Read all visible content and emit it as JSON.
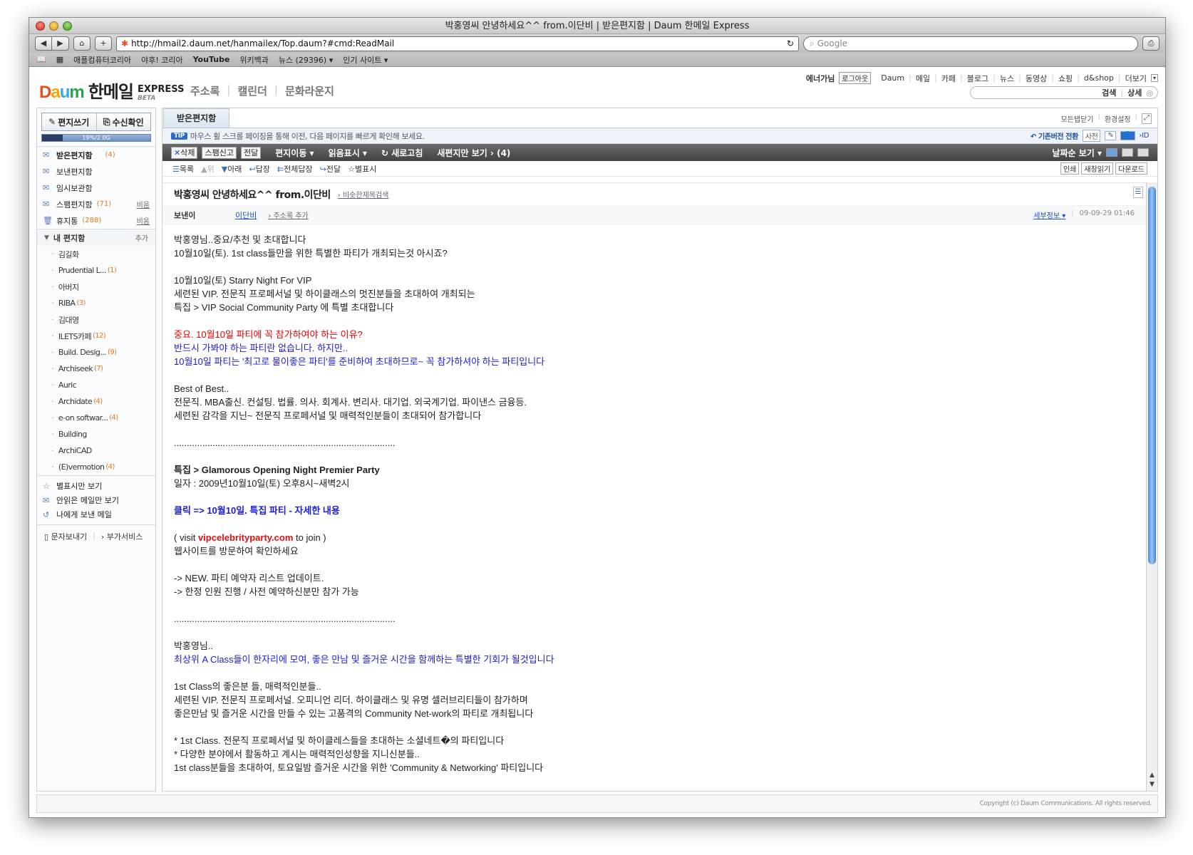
{
  "window": {
    "title": "박홍영씨 안녕하세요^^ from.이단비 | 받은편지함 | Daum 한메일 Express"
  },
  "browser": {
    "back_label": "◀",
    "forward_label": "▶",
    "home_label": "⌂",
    "add_label": "+",
    "url": "http://hmail2.daum.net/hanmailex/Top.daum?#cmd:ReadMail",
    "reload_label": "↻",
    "search_placeholder": "Google",
    "bookmarks": [
      "애플컴퓨터코리아",
      "야후! 코리아",
      "YouTube",
      "위키백과",
      "뉴스 (29396) ▾",
      "인기 사이트 ▾"
    ]
  },
  "header": {
    "brand": {
      "d1": "D",
      "d2": "a",
      "d3": "u",
      "d4": "m",
      "hanmail": "한메일",
      "express": "EXPRESS",
      "beta": "BETA"
    },
    "menu": [
      "주소록",
      "캘린더",
      "문화라운지"
    ],
    "user": "에너가님",
    "logout": "로그아웃",
    "links": [
      "Daum",
      "메일",
      "카페",
      "블로그",
      "뉴스",
      "동영상",
      "쇼핑",
      "d&shop",
      "더보기"
    ],
    "search_btn": "검색",
    "detail_btn": "상세"
  },
  "sidebar": {
    "compose": "편지쓰기",
    "check": "수신확인",
    "quota_text": "19%/2.0G",
    "folders": [
      {
        "name": "받은편지함",
        "count": "(4)",
        "empty": ""
      },
      {
        "name": "보낸편지함",
        "count": "",
        "empty": ""
      },
      {
        "name": "임시보관함",
        "count": "",
        "empty": ""
      },
      {
        "name": "스팸편지함",
        "count": "(71)",
        "empty": "비움"
      },
      {
        "name": "휴지통",
        "count": "(288)",
        "empty": "비움"
      }
    ],
    "myfolders_label": "내 편지함",
    "myfolders_add": "추가",
    "subfolders": [
      {
        "name": "김길화",
        "count": ""
      },
      {
        "name": "Prudential L...",
        "count": "(1)"
      },
      {
        "name": "아버지",
        "count": ""
      },
      {
        "name": "RIBA",
        "count": "(3)"
      },
      {
        "name": "김대영",
        "count": ""
      },
      {
        "name": "ILETS카페",
        "count": "(12)"
      },
      {
        "name": "Build. Desig...",
        "count": "(9)"
      },
      {
        "name": "Archiseek",
        "count": "(7)"
      },
      {
        "name": "Auric",
        "count": ""
      },
      {
        "name": "Archidate",
        "count": "(4)"
      },
      {
        "name": "e-on softwar...",
        "count": "(4)"
      },
      {
        "name": "Building",
        "count": ""
      },
      {
        "name": "ArchiCAD",
        "count": ""
      },
      {
        "name": "(E)vermotion",
        "count": "(4)"
      }
    ],
    "extras": [
      "별표시만 보기",
      "안읽은 메일만 보기",
      "나에게 보낸 메일"
    ],
    "sms": "문자보내기",
    "addon": "부가서비스"
  },
  "main": {
    "tab": "받은편지함",
    "tab_close_all": "모든탭닫기",
    "tab_settings": "환경설정",
    "tip_badge": "TIP",
    "tip_text": "마우스 휠 스크롤 페이징을 통해 이전, 다음 페이지를 빠르게 확인해 보세요.",
    "old_version": "기존버전 전환",
    "dict": "사전",
    "id_label": "ID",
    "actions": {
      "delete": "삭제",
      "spam": "스팸신고",
      "forward": "전달",
      "move": "편지이동 ▾",
      "mark": "읽음표시 ▾",
      "refresh": "새로고침",
      "new_only": "새편지만 보기 › (4)",
      "sort": "날짜순 보기 ▾"
    },
    "sub": {
      "list": "목록",
      "up": "위",
      "down": "아래",
      "reply": "답장",
      "reply_all": "전체답장",
      "fwd": "전달",
      "star": "별표시",
      "print": "인쇄",
      "new_window": "새창읽기",
      "download": "다운로드"
    }
  },
  "mail": {
    "subject": "박홍영씨 안녕하세요^^ from.이단비",
    "similar": "비슷한제목검색",
    "from_label": "보낸이",
    "from_name": "이단비",
    "add_contact": "주소록 추가",
    "detail": "세부정보 ▾",
    "date": "09-09-29 01:46",
    "lines": [
      {
        "t": "박홍영님..중요/추천 및 초대합니다",
        "c": ""
      },
      {
        "t": "10월10일(토). 1st class들만을 위한 특별한 파티가 개최되는것 아시죠?",
        "c": ""
      },
      {
        "t": "",
        "c": ""
      },
      {
        "t": "10월10일(토) Starry Night For VIP",
        "c": ""
      },
      {
        "t": "세련된 VIP. 전문직 프로페서널 및 하이클래스의 멋진분들을 초대하여 개최되는",
        "c": ""
      },
      {
        "t": "특집 > VIP Social Community Party 에 특별 초대합니다",
        "c": ""
      },
      {
        "t": "",
        "c": ""
      },
      {
        "t": "중요. 10월10일 파티에 꼭 참가하여야 하는 이유?",
        "c": "red"
      },
      {
        "t": "반드시 가봐야 하는 파티란 없습니다. 하지만..",
        "c": "blue"
      },
      {
        "t": "10월10일 파티는 '최고로 물이좋은 파티'를 준비하여 초대하므로~ 꼭 참가하셔야 하는 파티입니다",
        "c": "blue"
      },
      {
        "t": "",
        "c": ""
      },
      {
        "t": "Best of Best..",
        "c": ""
      },
      {
        "t": "전문직. MBA출신. 컨설팅. 법률. 의사. 회계사. 변리사. 대기업. 외국계기업. 파이낸스 금융등.",
        "c": ""
      },
      {
        "t": "세련된 감각을 지닌~ 전문직 프로페서널 및 매력적인분들이 초대되어 참가합니다",
        "c": ""
      },
      {
        "t": "",
        "c": ""
      },
      {
        "t": "......................................................................................",
        "c": ""
      },
      {
        "t": "",
        "c": ""
      },
      {
        "t": "특집 > Glamorous Opening Night Premier Party",
        "c": "bold"
      },
      {
        "t": "일자 : 2009년10월10일(토) 오후8시~새벽2시",
        "c": ""
      },
      {
        "t": "",
        "c": ""
      },
      {
        "t": "클릭 => 10월10일. 특집 파티 - 자세한 내용",
        "c": "blue bold"
      },
      {
        "t": "",
        "c": ""
      },
      {
        "t": "( visit |vipcelebrityparty.com| to join )",
        "c": "visit"
      },
      {
        "t": "웹사이트를 방문하여 확인하세요",
        "c": ""
      },
      {
        "t": "",
        "c": ""
      },
      {
        "t": "-> NEW. 파티 예약자 리스트 업데이트.",
        "c": ""
      },
      {
        "t": "-> 한정 인원 진행 / 사전 예약하신분만 참가 가능",
        "c": ""
      },
      {
        "t": "",
        "c": ""
      },
      {
        "t": "......................................................................................",
        "c": ""
      },
      {
        "t": "",
        "c": ""
      },
      {
        "t": "박홍영님..",
        "c": ""
      },
      {
        "t": "최상위 A Class들이 한자리에 모여, 좋은 만남 및 즐거운 시간을 함께하는 특별한 기회가 될것입니다",
        "c": "blue"
      },
      {
        "t": "",
        "c": ""
      },
      {
        "t": "1st Class의 좋은분 들, 매력적인분들..",
        "c": ""
      },
      {
        "t": "세련된 VIP. 전문직 프로페서널. 오피니언 리더. 하이클래스 및 유명 셀러브리티들이 참가하며",
        "c": ""
      },
      {
        "t": "좋은만남 및 즐거운 시간을 만들 수 있는 고품격의 Community Net-work의 파티로 개최됩니다",
        "c": ""
      },
      {
        "t": "",
        "c": ""
      },
      {
        "t": "* 1st Class. 전문직 프로페서널 및 하이클레스들을 초대하는 소셜네트�의 파티입니다",
        "c": ""
      },
      {
        "t": "* 다양한 분야에서 활동하고 계시는 매력적인성향을 지니신분들..",
        "c": ""
      },
      {
        "t": "  1st class분들을 초대하여, 토요일밤 즐거운 시간을 위한 'Community & Networking' 파티입니다",
        "c": ""
      }
    ]
  },
  "footer": {
    "copyright": "Copyright (c) Daum Communications. All rights reserved."
  },
  "colors": {
    "accent": "#2e6bc6",
    "count": "#e8771a",
    "red_text": "#ee0000",
    "blue_text": "#1c1cd8"
  }
}
